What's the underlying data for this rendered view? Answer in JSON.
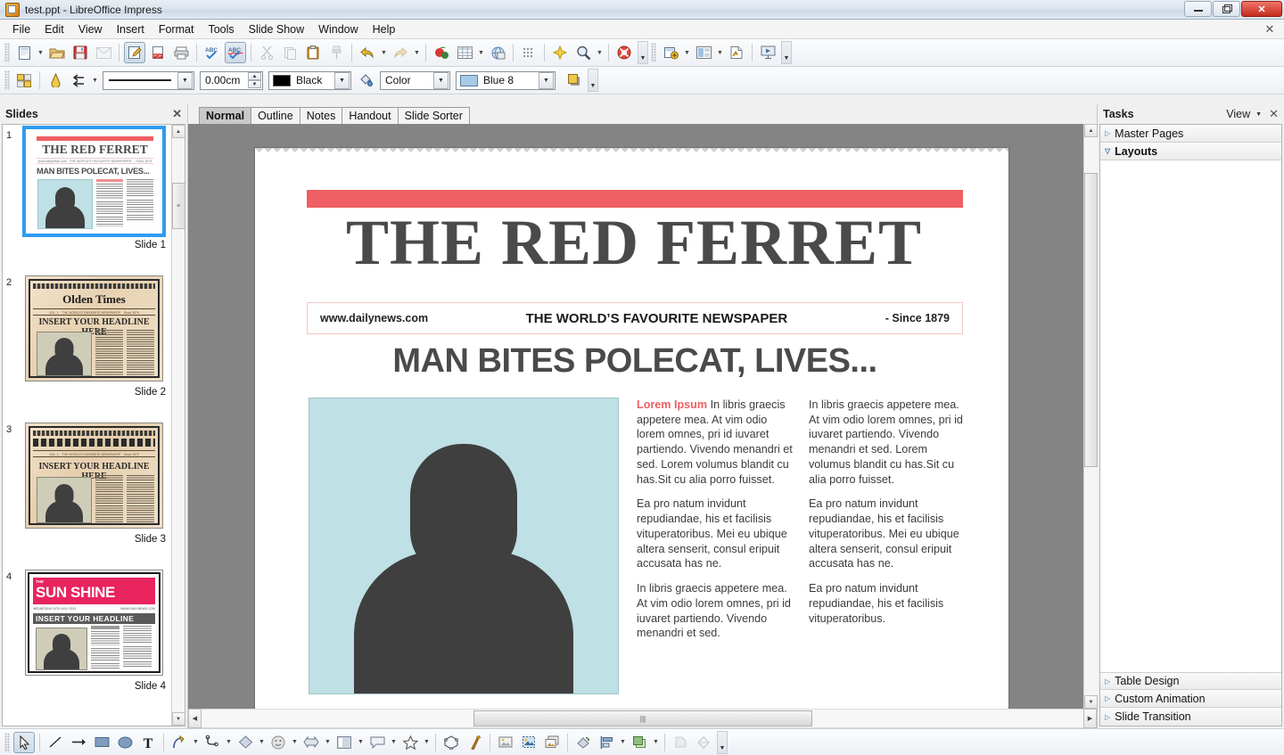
{
  "window": {
    "title": "test.ppt - LibreOffice Impress",
    "icon": "impress-document-icon",
    "minimize": "–",
    "maximize": "❐",
    "close": "✕"
  },
  "menubar": {
    "items": [
      "File",
      "Edit",
      "View",
      "Insert",
      "Format",
      "Tools",
      "Slide Show",
      "Window",
      "Help"
    ],
    "close_doc": "✕"
  },
  "toolbar_standard": {
    "buttons": [
      {
        "name": "new-document",
        "label": "New"
      },
      {
        "name": "open-document",
        "label": "Open"
      },
      {
        "name": "save-document",
        "label": "Save"
      },
      {
        "name": "email-document",
        "label": "E-mail Document"
      },
      {
        "name": "edit-file",
        "label": "Edit File"
      },
      {
        "name": "export-pdf",
        "label": "Export as PDF"
      },
      {
        "name": "print-file",
        "label": "Print File Directly"
      },
      {
        "name": "spelling",
        "label": "Spelling and Grammar"
      },
      {
        "name": "autospellcheck",
        "label": "AutoSpellcheck"
      },
      {
        "name": "cut",
        "label": "Cut"
      },
      {
        "name": "copy",
        "label": "Copy"
      },
      {
        "name": "paste",
        "label": "Paste"
      },
      {
        "name": "clone-formatting",
        "label": "Clone Formatting"
      },
      {
        "name": "undo",
        "label": "Undo"
      },
      {
        "name": "redo",
        "label": "Redo"
      },
      {
        "name": "display-grid",
        "label": "Display Grid"
      },
      {
        "name": "table",
        "label": "Table"
      },
      {
        "name": "hyperlink",
        "label": "Hyperlink"
      },
      {
        "name": "display-views",
        "label": "Display Views"
      },
      {
        "name": "show-draw-functions",
        "label": "Show Draw Functions"
      },
      {
        "name": "zoom",
        "label": "Zoom"
      },
      {
        "name": "help",
        "label": "LibreOffice Help"
      },
      {
        "name": "new-slide",
        "label": "New Slide"
      },
      {
        "name": "slide-layout",
        "label": "Slide Layout"
      },
      {
        "name": "slide-design",
        "label": "Slide Design"
      },
      {
        "name": "start-slideshow",
        "label": "Start from First Slide"
      }
    ],
    "overflow": "▼"
  },
  "toolbar_line_fill": {
    "line_style_label": "",
    "line_width_value": "0.00cm",
    "line_color_value": "Black",
    "line_color_hex": "#000000",
    "fill_style_value": "Color",
    "fill_color_value": "Blue 8",
    "fill_color_hex": "#a6cbe8",
    "shadow_label": "Shadow",
    "overflow": "▼",
    "buttons": [
      {
        "name": "display-grid-toggle",
        "label": "Grid"
      },
      {
        "name": "line-arrow-style",
        "label": "Arrow Style"
      },
      {
        "name": "area-style",
        "label": "Area Style / Filling"
      }
    ]
  },
  "slides_panel": {
    "title": "Slides",
    "close": "✕",
    "slides": [
      {
        "number": "1",
        "label": "Slide 1",
        "selected": true,
        "theme": "red-ferret",
        "masthead": "THE RED FERRET",
        "headline": "MAN BITES POLECAT, LIVES..."
      },
      {
        "number": "2",
        "label": "Slide 2",
        "selected": false,
        "theme": "olden-times",
        "masthead": "Olden Times",
        "headline": "INSERT YOUR HEADLINE HERE"
      },
      {
        "number": "3",
        "label": "Slide 3",
        "selected": false,
        "theme": "olden-times-alt",
        "masthead": "",
        "headline": "INSERT YOUR HEADLINE HERE"
      },
      {
        "number": "4",
        "label": "Slide 4",
        "selected": false,
        "theme": "sun-shine",
        "masthead_small": "THE",
        "masthead": "SUN SHINE",
        "headline": "INSERT YOUR HEADLINE HERE"
      }
    ],
    "scroll_up": "▲",
    "scroll_down": "▼"
  },
  "view_tabs": {
    "items": [
      "Normal",
      "Outline",
      "Notes",
      "Handout",
      "Slide Sorter"
    ],
    "selected": "Normal"
  },
  "slide": {
    "top_bar_color": "#ef5f63",
    "masthead": "THE RED FERRET",
    "strip": {
      "url": "www.dailynews.com",
      "tagline": "THE WORLD’S FAVOURITE NEWSPAPER",
      "since": "- Since 1879"
    },
    "headline": "MAN BITES POLECAT, LIVES...",
    "photo": {
      "name": "placeholder-portrait-silhouette",
      "background_hex": "#bfe0e4",
      "silhouette_hex": "#3f3f3f"
    },
    "columns": [
      {
        "paragraphs": [
          {
            "lead": "Lorem Ipsum",
            "text": " In libris graecis appetere mea. At vim odio lorem omnes, pri id iuvaret partiendo. Vivendo menandri et sed. Lorem volumus blandit cu has.Sit cu alia porro fuisset."
          },
          {
            "lead": "",
            "text": "Ea pro natum invidunt repudiandae, his et facilisis vituperatoribus. Mei eu ubique altera senserit, consul eripuit accusata has ne."
          },
          {
            "lead": "",
            "text": "In libris graecis appetere mea. At vim odio lorem omnes, pri id iuvaret partiendo. Vivendo menandri et sed."
          }
        ]
      },
      {
        "paragraphs": [
          {
            "lead": "",
            "text": "In libris graecis appetere mea. At vim odio lorem omnes, pri id iuvaret partiendo. Vivendo menandri et sed. Lorem volumus blandit cu has.Sit cu alia porro fuisset."
          },
          {
            "lead": "",
            "text": "Ea pro natum invidunt repudiandae, his et facilisis vituperatoribus. Mei eu ubique altera senserit, consul eripuit accusata has ne."
          },
          {
            "lead": "",
            "text": "Ea pro natum invidunt repudiandae, his et facilisis vituperatoribus."
          }
        ]
      }
    ]
  },
  "tasks_panel": {
    "title": "Tasks",
    "view_label": "View",
    "view_caret": "▼",
    "close": "✕",
    "sections": [
      {
        "label": "Master Pages",
        "open": false,
        "tri": "▷"
      },
      {
        "label": "Layouts",
        "open": true,
        "tri": "▽"
      },
      {
        "label": "Table Design",
        "open": false,
        "tri": "▷"
      },
      {
        "label": "Custom Animation",
        "open": false,
        "tri": "▷"
      },
      {
        "label": "Slide Transition",
        "open": false,
        "tri": "▷"
      }
    ]
  },
  "scrollbars": {
    "h_left": "◀",
    "h_right": "▶",
    "v_up": "▲",
    "v_down": "▼",
    "grip": "❙❙❙"
  },
  "drawbar": {
    "buttons": [
      {
        "name": "select-tool",
        "label": "Select",
        "active": true
      },
      {
        "name": "line-tool",
        "label": "Line"
      },
      {
        "name": "line-ends-arrow-tool",
        "label": "Line Ends with Arrow"
      },
      {
        "name": "rectangle-tool",
        "label": "Rectangle"
      },
      {
        "name": "ellipse-tool",
        "label": "Ellipse"
      },
      {
        "name": "text-box-tool",
        "label": "Insert Text Box"
      },
      {
        "name": "curve-tool",
        "label": "Curve"
      },
      {
        "name": "connector-tool",
        "label": "Connector"
      },
      {
        "name": "basic-shapes-tool",
        "label": "Basic Shapes"
      },
      {
        "name": "symbol-shapes-tool",
        "label": "Symbol Shapes"
      },
      {
        "name": "block-arrows-tool",
        "label": "Block Arrows"
      },
      {
        "name": "flowchart-tool",
        "label": "Flowchart"
      },
      {
        "name": "callouts-tool",
        "label": "Callouts"
      },
      {
        "name": "stars-tool",
        "label": "Stars"
      },
      {
        "name": "3d-objects-tool",
        "label": "3D Objects"
      },
      {
        "name": "rotate-tool",
        "label": "Rotate"
      },
      {
        "name": "alignment-tool",
        "label": "Alignment"
      },
      {
        "name": "arrange-tool",
        "label": "Arrange"
      },
      {
        "name": "shadow-tool",
        "label": "Shadow"
      },
      {
        "name": "crop-tool",
        "label": "Crop Image"
      },
      {
        "name": "filter-tool",
        "label": "Filter"
      },
      {
        "name": "points-tool",
        "label": "Points"
      },
      {
        "name": "glue-points-tool",
        "label": "Glue Points"
      },
      {
        "name": "fontwork-tool",
        "label": "Fontwork Gallery"
      },
      {
        "name": "insert-image-tool",
        "label": "Insert Image"
      },
      {
        "name": "gallery-tool",
        "label": "Gallery"
      }
    ],
    "overflow": "▼"
  }
}
